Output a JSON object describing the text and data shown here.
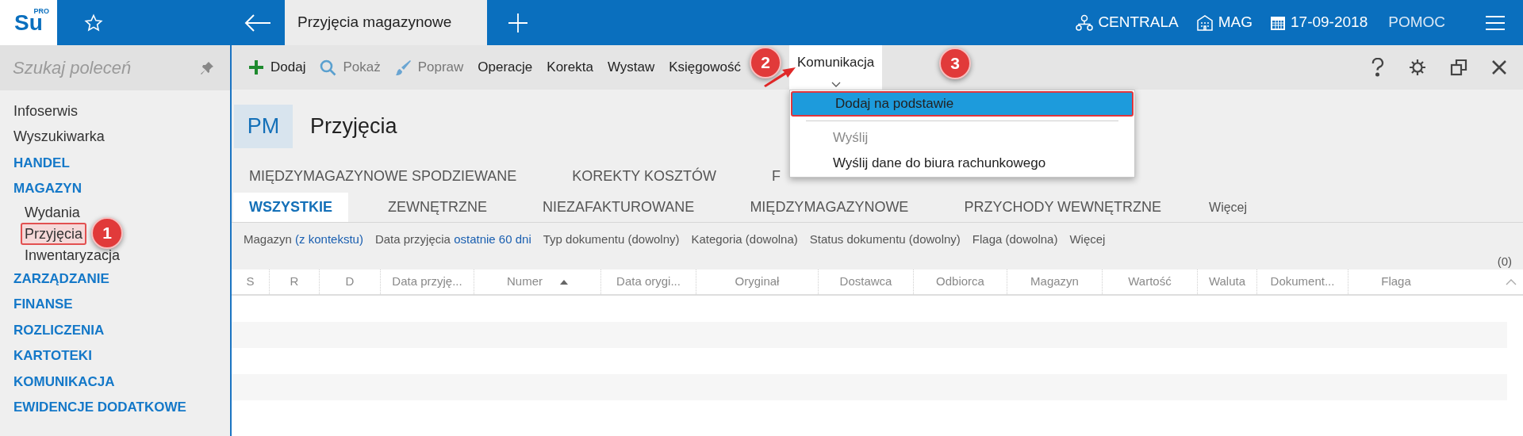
{
  "top_bar": {
    "logo": "Su",
    "logo_badge": "PRO",
    "document_tab": "Przyjęcia magazynowe",
    "items": [
      {
        "label": "CENTRALA",
        "kind": "network"
      },
      {
        "label": "MAG",
        "kind": "building"
      },
      {
        "label": "17-09-2018",
        "kind": "calendar"
      },
      {
        "label": "POMOC",
        "kind": "text"
      }
    ]
  },
  "sidebar": {
    "search": {
      "placeholder": "Szukaj poleceń"
    },
    "items": [
      {
        "label": "Infoserwis",
        "kind": "link"
      },
      {
        "label": "Wyszukiwarka",
        "kind": "link"
      },
      {
        "label": "HANDEL",
        "kind": "section"
      },
      {
        "label": "MAGAZYN",
        "kind": "section",
        "children": [
          {
            "label": "Wydania",
            "highlighted": false
          },
          {
            "label": "Przyjęcia",
            "highlighted": true,
            "callout": "1"
          },
          {
            "label": "Inwentaryzacja",
            "highlighted": false
          }
        ]
      },
      {
        "label": "ZARZĄDZANIE",
        "kind": "section"
      },
      {
        "label": "FINANSE",
        "kind": "section"
      },
      {
        "label": "ROZLICZENIA",
        "kind": "section"
      },
      {
        "label": "KARTOTEKI",
        "kind": "section"
      },
      {
        "label": "KOMUNIKACJA",
        "kind": "section"
      },
      {
        "label": "EWIDENCJE DODATKOWE",
        "kind": "section"
      }
    ]
  },
  "toolbar": {
    "items": [
      {
        "label": "Dodaj",
        "kind": "add",
        "disabled": false
      },
      {
        "label": "Pokaż",
        "kind": "search",
        "disabled": true
      },
      {
        "label": "Popraw",
        "kind": "brush",
        "disabled": true
      },
      {
        "label": "Operacje",
        "kind": "text",
        "disabled": false
      },
      {
        "label": "Korekta",
        "kind": "text",
        "disabled": false
      },
      {
        "label": "Wystaw",
        "kind": "text",
        "disabled": false
      },
      {
        "label": "Księgowość",
        "kind": "text",
        "disabled": false
      },
      {
        "label": "Komunikacja",
        "kind": "menu",
        "disabled": false,
        "open": true,
        "callout": "2"
      }
    ]
  },
  "dropdown": {
    "items": [
      {
        "kind": "item",
        "label": "Dodaj na podstawie",
        "selected": true,
        "disabled": false,
        "callout": "3"
      },
      {
        "kind": "separator"
      },
      {
        "kind": "item",
        "label": "Wyślij",
        "selected": false,
        "disabled": true
      },
      {
        "kind": "item",
        "label": "Wyślij dane do biura rachunkowego",
        "selected": false,
        "disabled": false
      }
    ]
  },
  "header": {
    "badge": "PM",
    "title": "Przyjęcia"
  },
  "tabs_row_1": [
    "MIĘDZYMAGAZYNOWE SPODZIEWANE",
    "KOREKTY KOSZTÓW",
    "F"
  ],
  "tabs": [
    {
      "label": "WSZYSTKIE",
      "selected": true
    },
    {
      "label": "ZEWNĘTRZNE",
      "selected": false
    },
    {
      "label": "NIEZAFAKTUROWANE",
      "selected": false
    },
    {
      "label": "MIĘDZYMAGAZYNOWE",
      "selected": false
    },
    {
      "label": "PRZYCHODY WEWNĘTRZNE",
      "selected": false
    }
  ],
  "tabs_more": "Więcej",
  "filters": [
    {
      "label": "Magazyn",
      "value": "(z kontekstu)"
    },
    {
      "label": "Data przyjęcia",
      "value": "ostatnie 60 dni"
    },
    {
      "label": "Typ dokumentu (dowolny)"
    },
    {
      "label": "Kategoria (dowolna)"
    },
    {
      "label": "Status dokumentu (dowolny)"
    },
    {
      "label": "Flaga (dowolna)"
    },
    {
      "label": "Więcej"
    }
  ],
  "count": "(0)",
  "table": {
    "columns": [
      {
        "label": "S",
        "sorted": false
      },
      {
        "label": "R",
        "sorted": false
      },
      {
        "label": "D",
        "sorted": false
      },
      {
        "label": "Data przyję...",
        "sorted": false
      },
      {
        "label": "Numer",
        "sorted": true
      },
      {
        "label": "Data orygi...",
        "sorted": false
      },
      {
        "label": "Oryginał",
        "sorted": false
      },
      {
        "label": "Dostawca",
        "sorted": false
      },
      {
        "label": "Odbiorca",
        "sorted": false
      },
      {
        "label": "Magazyn",
        "sorted": false
      },
      {
        "label": "Wartość",
        "sorted": false
      },
      {
        "label": "Waluta",
        "sorted": false
      },
      {
        "label": "Dokument...",
        "sorted": false
      },
      {
        "label": "Flaga",
        "sorted": false
      }
    ]
  }
}
